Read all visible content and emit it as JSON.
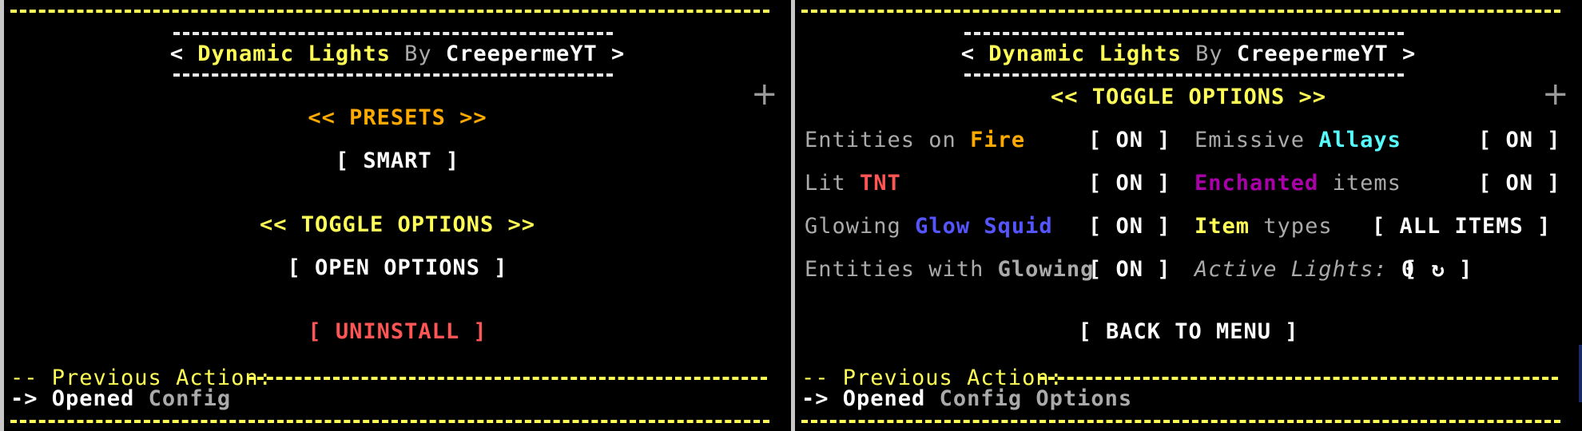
{
  "left": {
    "title_open": "<",
    "title_name": "Dynamic Lights",
    "title_by": "By",
    "title_author": "CreepermeYT",
    "title_close": ">",
    "presets_heading": "<< PRESETS >>",
    "preset_button": "[ SMART ]",
    "toggle_heading": "<< TOGGLE OPTIONS >>",
    "open_options_button": "[ OPEN OPTIONS ]",
    "uninstall_button": "[ UNINSTALL ]",
    "previous_action_label": "-- Previous Action:",
    "previous_action_arrow": "->",
    "previous_action_verb": "Opened",
    "previous_action_object": "Config"
  },
  "right": {
    "title_open": "<",
    "title_name": "Dynamic Lights",
    "title_by": "By",
    "title_author": "CreepermeYT",
    "title_close": ">",
    "toggle_heading": "<< TOGGLE OPTIONS >>",
    "options": {
      "fire": {
        "prefix": "Entities on",
        "highlight": "Fire",
        "state": "[ ON ]"
      },
      "tnt": {
        "prefix": "Lit",
        "highlight": "TNT",
        "state": "[ ON ]"
      },
      "glow_squid": {
        "prefix": "Glowing",
        "highlight": "Glow Squid",
        "state": "[ ON ]"
      },
      "glowing": {
        "prefix": "Entities with",
        "highlight": "Glowing",
        "state": "[ ON ]"
      },
      "allays": {
        "prefix": "Emissive",
        "highlight": "Allays",
        "state": "[ ON ]"
      },
      "enchanted": {
        "highlight": "Enchanted",
        "suffix": "items",
        "state": "[ ON ]"
      },
      "item_types": {
        "highlight": "Item",
        "suffix": "types",
        "state": "[ ALL ITEMS ]"
      }
    },
    "active_lights_label": "Active Lights:",
    "active_lights_value": "0",
    "refresh_open": "[",
    "refresh_icon": "↻",
    "refresh_close": "]",
    "back_button": "[ BACK TO MENU ]",
    "previous_action_label": "-- Previous Action:",
    "previous_action_arrow": "->",
    "previous_action_verb": "Opened",
    "previous_action_object": "Config Options"
  },
  "icons": {
    "plus": "+"
  },
  "colors": {
    "yellow": "#ffff55",
    "gold": "#ffaa00",
    "white": "#ffffff",
    "gray": "#aaaaaa",
    "red": "#ff5555",
    "blue": "#5555ff",
    "aqua": "#55ffff",
    "purple": "#aa00aa",
    "background": "#000000"
  }
}
